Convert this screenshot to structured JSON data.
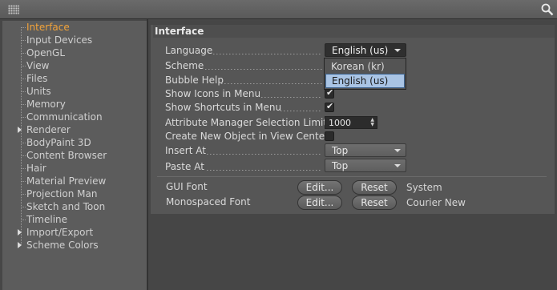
{
  "sidebar": {
    "items": [
      {
        "label": "Interface"
      },
      {
        "label": "Input Devices"
      },
      {
        "label": "OpenGL"
      },
      {
        "label": "View"
      },
      {
        "label": "Files"
      },
      {
        "label": "Units"
      },
      {
        "label": "Memory"
      },
      {
        "label": "Communication"
      },
      {
        "label": "Renderer"
      },
      {
        "label": "BodyPaint 3D"
      },
      {
        "label": "Content Browser"
      },
      {
        "label": "Hair"
      },
      {
        "label": "Material Preview"
      },
      {
        "label": "Projection Man"
      },
      {
        "label": "Sketch and Toon"
      },
      {
        "label": "Timeline"
      },
      {
        "label": "Import/Export"
      },
      {
        "label": "Scheme Colors"
      }
    ]
  },
  "panel": {
    "title": "Interface",
    "language": {
      "label": "Language",
      "value": "English (us)",
      "options": [
        "Korean (kr)",
        "English (us)"
      ]
    },
    "scheme": {
      "label": "Scheme"
    },
    "bubble_help": {
      "label": "Bubble Help"
    },
    "show_icons": {
      "label": "Show Icons in Menu",
      "checked": true
    },
    "show_shortcuts": {
      "label": "Show Shortcuts in Menu",
      "checked": true
    },
    "attr_limit": {
      "label": "Attribute Manager Selection Limit",
      "value": "1000"
    },
    "create_new": {
      "label": "Create New Object in View Center",
      "checked": false
    },
    "insert_at": {
      "label": "Insert At",
      "value": "Top"
    },
    "paste_at": {
      "label": "Paste At",
      "value": "Top"
    },
    "gui_font": {
      "label": "GUI Font",
      "edit": "Edit...",
      "reset": "Reset",
      "value": "System"
    },
    "mono_font": {
      "label": "Monospaced Font",
      "edit": "Edit...",
      "reset": "Reset",
      "value": "Courier New"
    }
  },
  "colors": {
    "active_item": "#f2a33a",
    "selection": "#a9c4e4"
  },
  "icons": {
    "grip": "grip-icon",
    "search": "search-icon"
  }
}
